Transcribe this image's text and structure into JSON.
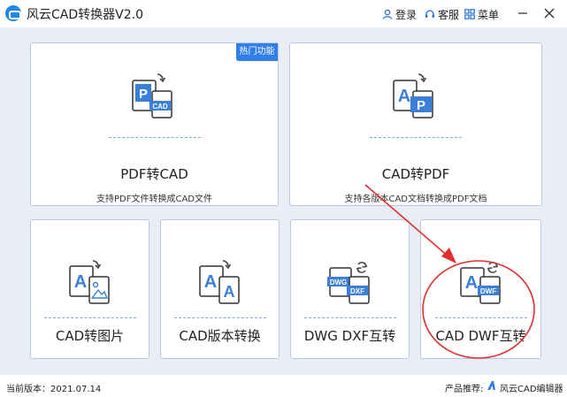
{
  "app": {
    "title": "风云CAD转换器V2.0",
    "actions": {
      "login": "登录",
      "service": "客服",
      "menu": "菜单"
    }
  },
  "cards": {
    "pdf_to_cad": {
      "title": "PDF转CAD",
      "description": "支持PDF文件转换成CAD文件",
      "badge": "热门功能",
      "icon_letters": [
        "P",
        "CAD"
      ]
    },
    "cad_to_pdf": {
      "title": "CAD转PDF",
      "description": "支持各版本CAD文档转换成PDF文档",
      "icon_letters": [
        "A",
        "P"
      ]
    },
    "cad_to_image": {
      "title": "CAD转图片",
      "icon_letters": [
        "A"
      ]
    },
    "cad_version": {
      "title": "CAD版本转换",
      "icon_letters": [
        "A",
        "A"
      ]
    },
    "dwg_dxf": {
      "title": "DWG DXF互转",
      "icon_letters": [
        "DWG",
        "DXF"
      ]
    },
    "cad_dwf": {
      "title": "CAD DWF互转",
      "icon_letters": [
        "A",
        "DWF"
      ]
    }
  },
  "status": {
    "version": "当前版本：2021.07.14",
    "recommend_label": "产品推荐:",
    "recommend_product": "风云CAD编辑器"
  },
  "colors": {
    "accent": "#2f7ee9",
    "icon_blue": "#3a7fd8",
    "card_border": "#b9c9e4",
    "background": "#e9eef6",
    "annotation": "#e0302d"
  }
}
